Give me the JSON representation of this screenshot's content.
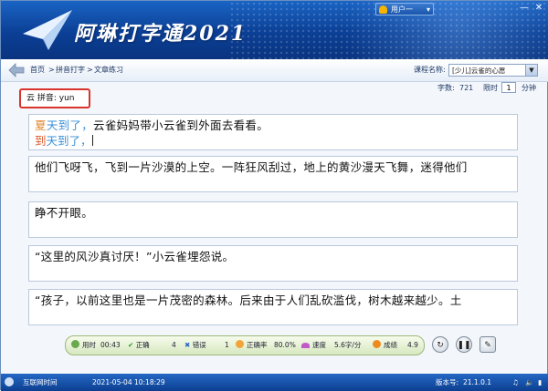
{
  "app": {
    "title": "阿琳打字通2021",
    "user_menu": "用户一",
    "window_controls": [
      "minimize-icon",
      "close-icon"
    ]
  },
  "nav": {
    "breadcrumbs": [
      "首页",
      "拼音打字",
      "文章练习"
    ],
    "separator": ">",
    "course_label": "课程名称:",
    "course_value": "[少儿]云雀的心愿"
  },
  "stats": {
    "char_count_label": "字数:",
    "char_count": "721",
    "time_limit_label": "限时",
    "time_limit_value": "1",
    "time_limit_unit": "分钟"
  },
  "hint": {
    "text": "云 拼音: yun"
  },
  "lines": [
    {
      "source": "夏天到了，云雀妈妈带小云雀到外面去看看。",
      "typed_segments": [
        {
          "text": "到",
          "state": "wrong"
        },
        {
          "text": "天到了，",
          "state": "correct"
        }
      ]
    },
    {
      "source": "他们飞呀飞，飞到一片沙漠的上空。一阵狂风刮过，地上的黄沙漫天飞舞，迷得他们"
    },
    {
      "source": "睁不开眼。"
    },
    {
      "source": "“这里的风沙真讨厌！”小云雀埋怨说。"
    },
    {
      "source": "“孩子，以前这里也是一片茂密的森林。后来由于人们乱砍滥伐，树木越来越少。土"
    }
  ],
  "first_line_prefix": {
    "highlight": "夏",
    "done": "天到了，",
    "rest": "云雀妈妈带小云雀到外面去看看。"
  },
  "statusbar": {
    "time_label": "用时",
    "time_value": "00:43",
    "correct_label": "正确",
    "correct_value": "4",
    "wrong_label": "错误",
    "wrong_value": "1",
    "accuracy_label": "正确率",
    "accuracy_value": "80.0%",
    "speed_label": "速度",
    "speed_value": "5.6字/分",
    "score_label": "成绩",
    "score_value": "4.9"
  },
  "controls": [
    "restart-icon",
    "pause-icon",
    "settings-icon"
  ],
  "footer": {
    "left_label": "互联网时间",
    "datetime": "2021-05-04 10:18:29",
    "version_label": "版本号:",
    "version": "21.1.0.1"
  },
  "colors": {
    "header_blue": "#0b3f95",
    "correct": "#3a8fd8",
    "wrong": "#d95a2b",
    "hint_border": "#d9342b"
  }
}
